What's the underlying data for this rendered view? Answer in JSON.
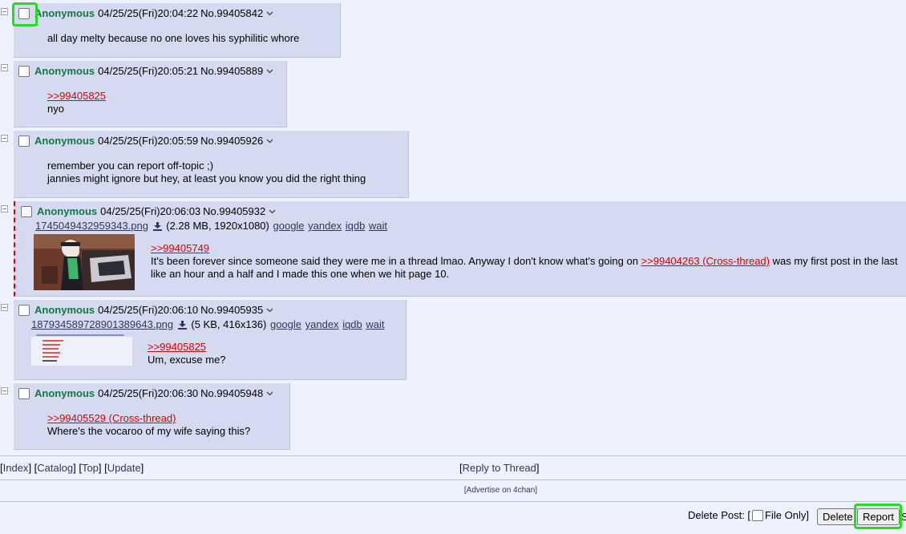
{
  "colors": {
    "name": "#117743",
    "quote": "#dd0000",
    "link": "#34345c",
    "post_bg": "#d6daf0",
    "page_bg": "#eef2ff",
    "highlight": "#22dd22"
  },
  "posts": [
    {
      "name": "Anonymous",
      "datetime": "04/25/25(Fri)20:04:22",
      "no": "No.99405842",
      "lines": [
        "all day melty because no one loves his syphilitic whore"
      ]
    },
    {
      "name": "Anonymous",
      "datetime": "04/25/25(Fri)20:05:21",
      "no": "No.99405889",
      "quote": ">>99405825",
      "lines": [
        "nyo"
      ]
    },
    {
      "name": "Anonymous",
      "datetime": "04/25/25(Fri)20:05:59",
      "no": "No.99405926",
      "lines": [
        "remember you can report off-topic ;)",
        "jannies might ignore but hey, at least you know you did the right thing"
      ]
    },
    {
      "name": "Anonymous",
      "datetime": "04/25/25(Fri)20:06:03",
      "no": "No.99405932",
      "file": {
        "name": "1745049432959343.png",
        "meta": "(2.28 MB, 1920x1080)"
      },
      "quote": ">>99405749",
      "line1_pre": "It's been forever since someone said they were me in a thread lmao. Anyway I don't know what's going on ",
      "line1_link": ">>99404263 (Cross-thread)",
      "line1_post": " was my first post in the last",
      "line2": "like an hour and a half and I made this one when we hit page 10."
    },
    {
      "name": "Anonymous",
      "datetime": "04/25/25(Fri)20:06:10",
      "no": "No.99405935",
      "file": {
        "name": "1879345897289013896​43.png",
        "meta": "(5 KB, 416x136)"
      },
      "quote": ">>99405825",
      "lines": [
        "Um, excuse me?"
      ]
    },
    {
      "name": "Anonymous",
      "datetime": "04/25/25(Fri)20:06:30",
      "no": "No.99405948",
      "quote": ">>99405529 (Cross-thread)",
      "lines": [
        "Where's the vocaroo of my wife saying this?"
      ]
    }
  ],
  "search_links": [
    "google",
    "yandex",
    "iqdb",
    "wait"
  ],
  "nav": {
    "index": "Index",
    "catalog": "Catalog",
    "top": "Top",
    "update": "Update",
    "reply": "Reply to Thread"
  },
  "advertise": "[Advertise on 4chan]",
  "footer": {
    "delete_post": "Delete Post: [",
    "file_only": "File Only]",
    "delete_btn": "Delete",
    "report_btn": "Report",
    "trailing": "S"
  }
}
